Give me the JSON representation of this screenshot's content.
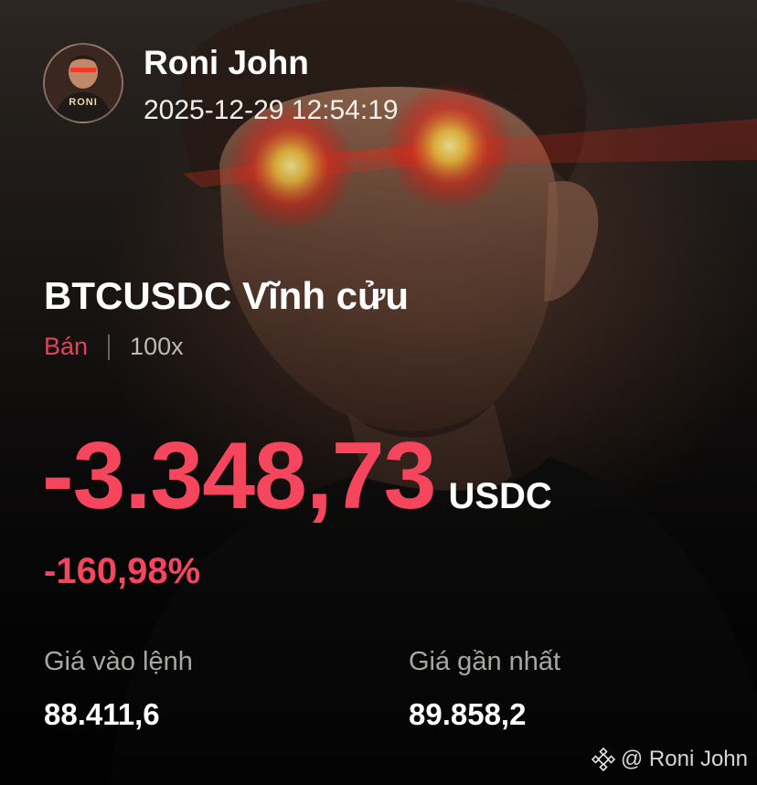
{
  "user": {
    "name": "Roni John",
    "timestamp": "2025-12-29 12:54:19",
    "avatar_text": "RONI"
  },
  "position": {
    "symbol": "BTCUSDC Vĩnh cửu",
    "side": "Bán",
    "leverage": "100x",
    "pnl": "-3.348,73",
    "pnl_unit": "USDC",
    "pnl_percent": "-160,98%"
  },
  "stats": {
    "entry_label": "Giá vào lệnh",
    "entry_value": "88.411,6",
    "last_label": "Giá gần nhất",
    "last_value": "89.858,2"
  },
  "watermark": {
    "text": "@ Roni John",
    "icon": "binance-logo-icon"
  },
  "colors": {
    "loss": "#f6465d",
    "side_sell": "#e0445f",
    "muted": "#a9a7a3"
  }
}
